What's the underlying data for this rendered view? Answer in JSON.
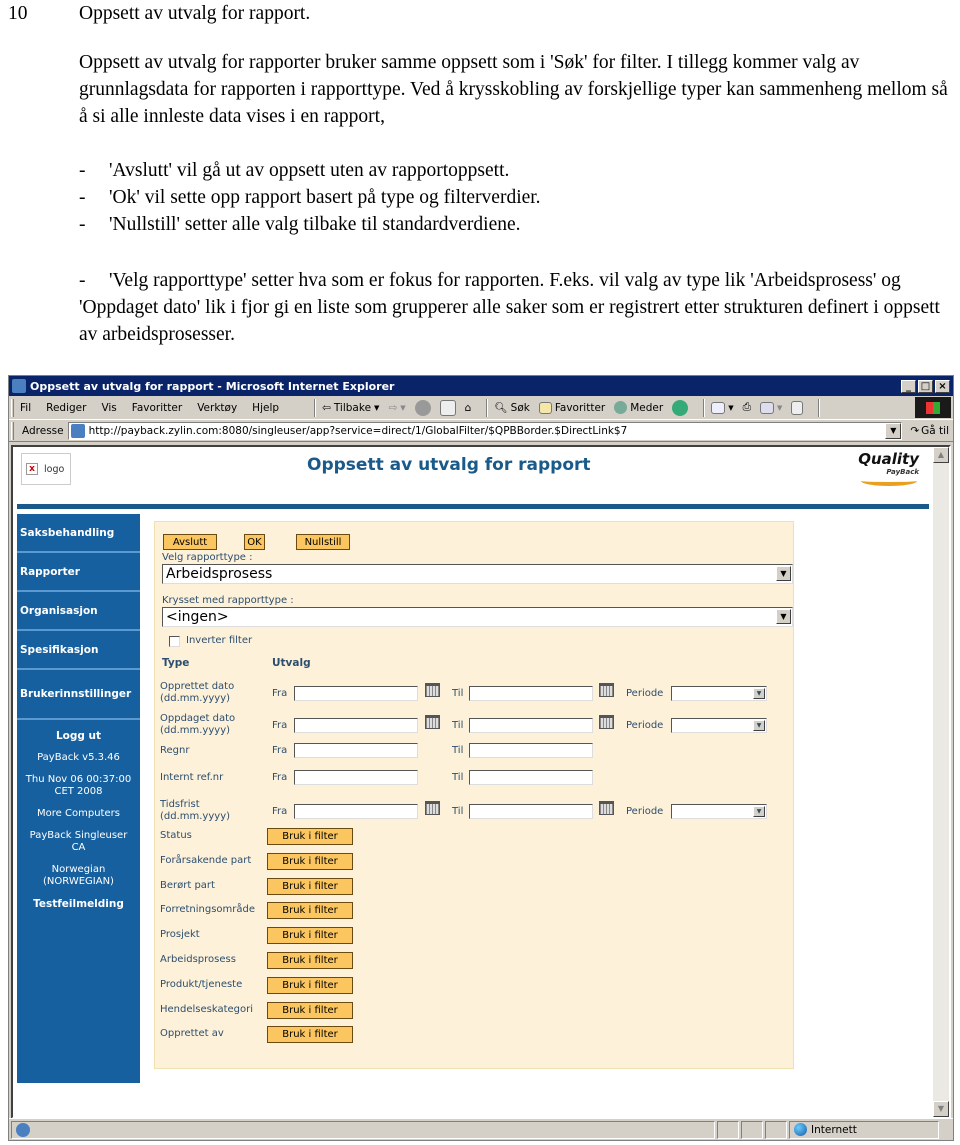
{
  "document": {
    "section_number": "10",
    "heading": "Oppsett av utvalg for rapport.",
    "paragraph": "Oppsett av utvalg for rapporter bruker samme oppsett som i 'Søk' for filter. I tillegg kommer valg av grunnlagsdata for rapporten i rapporttype. Ved å krysskobling av forskjellige typer kan sammenheng mellom så å si alle innleste data vises i en rapport,",
    "bullets": [
      "'Avslutt' vil gå ut av oppsett uten av rapportoppsett.",
      "'Ok' vil sette opp rapport basert på type og filterverdier.",
      "'Nullstill' setter alle valg tilbake til standardverdiene."
    ],
    "bullet_dash": "-",
    "paragraph2": "'Velg rapporttype' setter hva som er fokus for rapporten. F.eks. vil valg av type lik 'Arbeidsprosess' og 'Oppdaget dato' lik i fjor gi en liste som grupperer alle saker som er registrert etter strukturen definert i oppsett av arbeidsprosesser."
  },
  "browser": {
    "title": "Oppsett av utvalg for rapport - Microsoft Internet Explorer",
    "window_buttons": [
      "_",
      "□",
      "×"
    ],
    "menu": [
      "Fil",
      "Rediger",
      "Vis",
      "Favoritter",
      "Verktøy",
      "Hjelp"
    ],
    "toolbar": {
      "back": "Tilbake",
      "search": "Søk",
      "favorites": "Favoritter",
      "media": "Meder"
    },
    "address_label": "Adresse",
    "url": "http://payback.zylin.com:8080/singleuser/app?service=direct/1/GlobalFilter/$QPBBorder.$DirectLink$7",
    "go_label": "Gå til",
    "status_zone": "Internett"
  },
  "page": {
    "logo_alt": "logo",
    "title": "Oppsett av utvalg for rapport",
    "brand": {
      "line1": "Quality",
      "line2": "PayBack"
    },
    "sidebar": {
      "nav": [
        "Saksbehandling",
        "Rapporter",
        "Organisasjon",
        "Spesifikasjon",
        "Brukerinnstillinger"
      ],
      "logout": "Logg ut",
      "version": "PayBack v5.3.46",
      "datetime": "Thu Nov 06 00:37:00 CET 2008",
      "company": "More Computers",
      "product": "PayBack Singleuser CA",
      "language": "Norwegian (NORWEGIAN)",
      "test": "Testfeilmelding"
    },
    "form": {
      "buttons": {
        "cancel": "Avslutt",
        "ok": "OK",
        "reset": "Nullstill"
      },
      "report_type_label": "Velg rapporttype :",
      "report_type_value": "Arbeidsprosess",
      "cross_label": "Krysset med rapporttype :",
      "cross_value": "<ingen>",
      "invert_label": "Inverter filter",
      "invert_checked": false,
      "col_type": "Type",
      "col_selection": "Utvalg",
      "from_label": "Fra",
      "to_label": "Til",
      "period_label": "Periode",
      "range_rows": [
        {
          "label": "Opprettet dato (dd.mm.yyyy)",
          "calendar": true,
          "period": true
        },
        {
          "label": "Oppdaget dato (dd.mm.yyyy)",
          "calendar": true,
          "period": true
        },
        {
          "label": "Regnr",
          "calendar": false,
          "period": false
        },
        {
          "label": "Internt ref.nr",
          "calendar": false,
          "period": false
        },
        {
          "label": "Tidsfrist (dd.mm.yyyy)",
          "calendar": true,
          "period": true
        }
      ],
      "filter_button_label": "Bruk i filter",
      "filter_rows": [
        "Status",
        "Forårsakende part",
        "Berørt part",
        "Forretningsområde",
        "Prosjekt",
        "Arbeidsprosess",
        "Produkt/tjeneste",
        "Hendelseskategori",
        "Opprettet av"
      ]
    }
  }
}
